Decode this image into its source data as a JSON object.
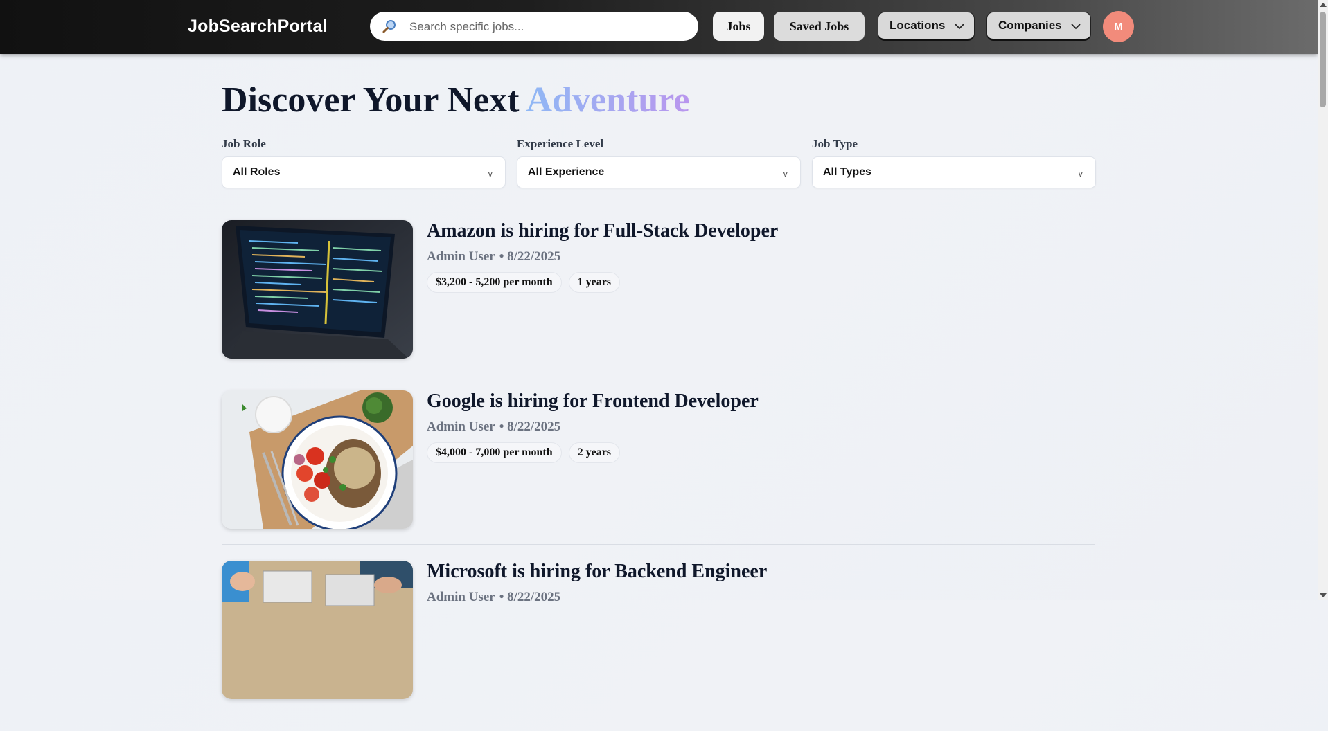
{
  "header": {
    "logo": "JobSearchPortal",
    "search_placeholder": "Search specific jobs...",
    "nav": {
      "jobs": "Jobs",
      "saved_jobs": "Saved Jobs",
      "locations": "Locations",
      "companies": "Companies"
    },
    "avatar_initial": "M"
  },
  "page": {
    "title_main": "Discover Your Next ",
    "title_accent": "Adventure"
  },
  "filters": [
    {
      "label": "Job Role",
      "value": "All Roles"
    },
    {
      "label": "Experience Level",
      "value": "All Experience"
    },
    {
      "label": "Job Type",
      "value": "All Types"
    }
  ],
  "filter_arrow": "v",
  "jobs": [
    {
      "title": "Amazon is hiring for Full-Stack Developer",
      "author": "Admin User",
      "date": "• 8/22/2025",
      "salary": "$3,200 - 5,200 per month",
      "experience": "1 years",
      "image": "laptop-code"
    },
    {
      "title": "Google is hiring for Frontend Developer",
      "author": "Admin User",
      "date": "• 8/22/2025",
      "salary": "$4,000 - 7,000 per month",
      "experience": "2 years",
      "image": "food-plate"
    },
    {
      "title": "Microsoft is hiring for Backend Engineer",
      "author": "Admin User",
      "date": "• 8/22/2025",
      "salary": "",
      "experience": "",
      "image": "team-laptops"
    }
  ],
  "colors": {
    "accent_start": "#8fb8f5",
    "accent_end": "#b996ee",
    "avatar": "#f28b7b"
  }
}
